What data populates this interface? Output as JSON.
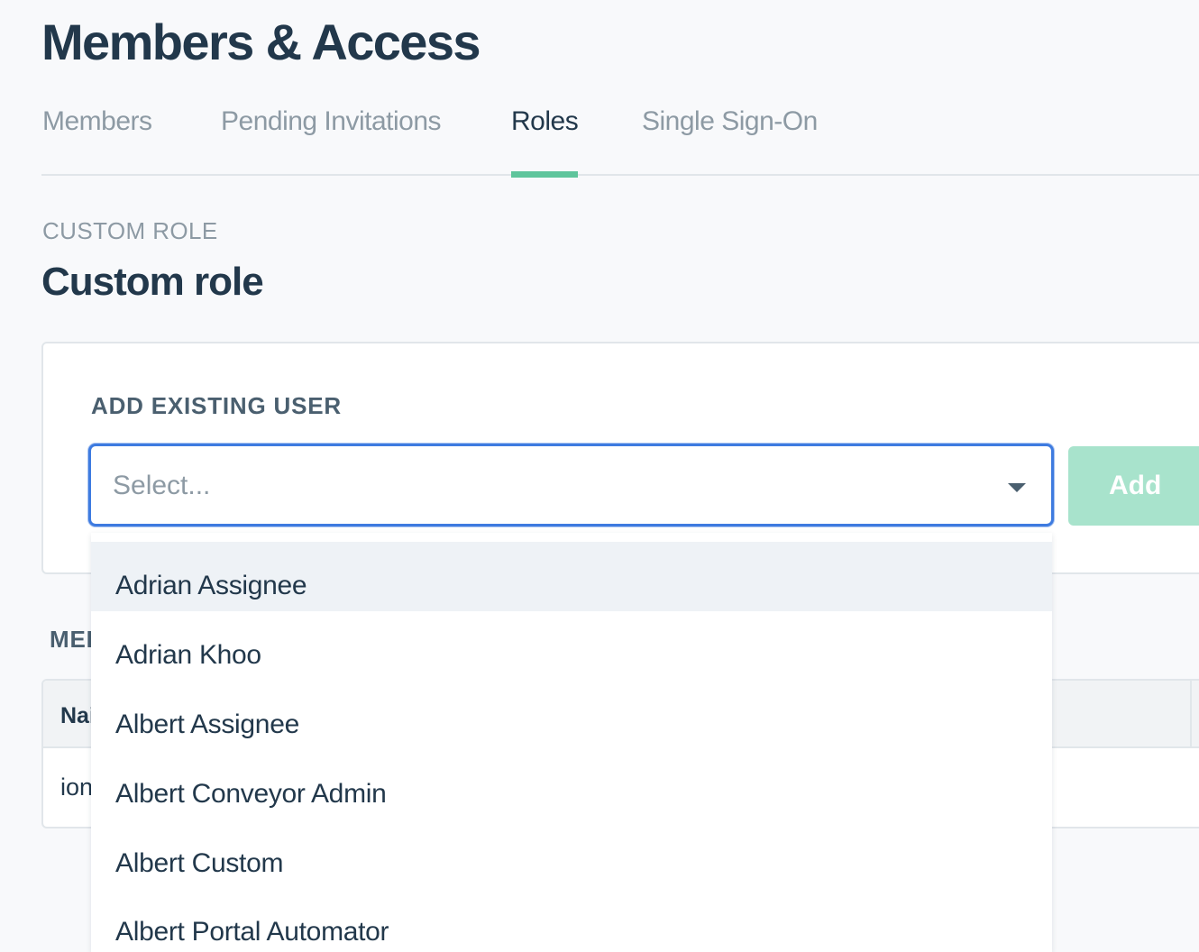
{
  "page": {
    "title": "Members & Access"
  },
  "tabs": [
    {
      "label": "Members",
      "active": false
    },
    {
      "label": "Pending Invitations",
      "active": false
    },
    {
      "label": "Roles",
      "active": true
    },
    {
      "label": "Single Sign-On",
      "active": false
    }
  ],
  "role": {
    "kicker": "CUSTOM ROLE",
    "title": "Custom role"
  },
  "add_user": {
    "label": "ADD EXISTING USER",
    "placeholder": "Select...",
    "add_label": "Add"
  },
  "members_table": {
    "heading": "MEI",
    "header": {
      "name": "Nai"
    },
    "rows": [
      {
        "name": "ion"
      }
    ]
  },
  "dropdown": {
    "highlighted_index": 0,
    "options": [
      "Adrian Assignee",
      "Adrian Khoo",
      "Albert Assignee",
      "Albert Conveyor Admin",
      "Albert Custom",
      "Albert Portal Automator"
    ]
  },
  "colors": {
    "text_primary": "#22384b",
    "text_muted": "#8d9aa4",
    "accent_green": "#5fc59c",
    "add_button_disabled": "#a8e3cc",
    "focus_blue": "#3e7be0",
    "highlight_row": "#eef2f6"
  },
  "icons": {
    "select_caret": "chevron-down-icon"
  }
}
